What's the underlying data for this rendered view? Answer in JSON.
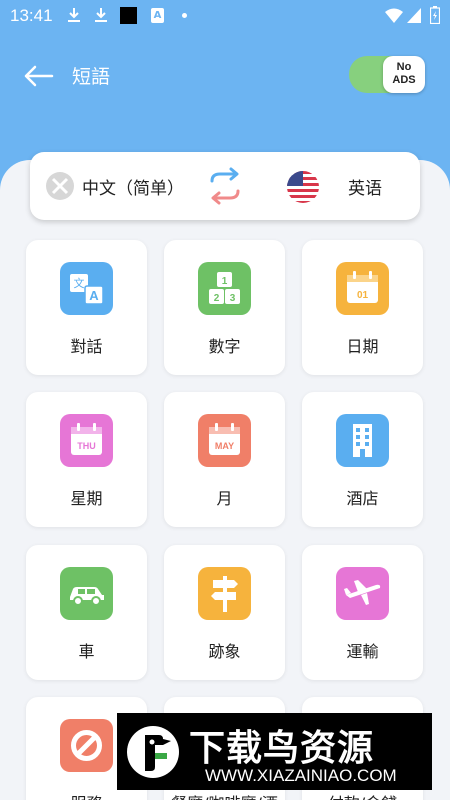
{
  "status_bar": {
    "time": "13:41",
    "a_glyph": "A"
  },
  "header": {
    "title": "短語"
  },
  "no_ads": {
    "line1": "No",
    "line2": "ADS"
  },
  "language": {
    "from": "中文（简单）",
    "to": "英语"
  },
  "categories": [
    {
      "label": "對話",
      "color": "#5aaef0",
      "icon": "translate-icon"
    },
    {
      "label": "數字",
      "color": "#6ec165",
      "icon": "number-blocks-icon"
    },
    {
      "label": "日期",
      "color": "#f6b33d",
      "icon": "calendar-icon",
      "icon_text": "01"
    },
    {
      "label": "星期",
      "color": "#e676d6",
      "icon": "weekday-calendar-icon",
      "icon_text": "THU"
    },
    {
      "label": "月",
      "color": "#f07f68",
      "icon": "month-calendar-icon",
      "icon_text": "MAY"
    },
    {
      "label": "酒店",
      "color": "#5aaef0",
      "icon": "hotel-icon"
    },
    {
      "label": "車",
      "color": "#6ec165",
      "icon": "car-icon"
    },
    {
      "label": "跡象",
      "color": "#f6b33d",
      "icon": "signpost-icon"
    },
    {
      "label": "運輸",
      "color": "#e676d6",
      "icon": "airplane-icon"
    },
    {
      "label": "服務",
      "color": "#f07f68",
      "icon": "service-icon"
    },
    {
      "label": "餐廳/咖啡廳/酒",
      "color": "#5aaef0",
      "icon": "restaurant-icon"
    },
    {
      "label": "付款/金錢",
      "color": "#6ec165",
      "icon": "money-icon"
    }
  ],
  "watermark": {
    "title": "下载鸟资源",
    "url": "WWW.XIAZAINIAO.COM"
  }
}
